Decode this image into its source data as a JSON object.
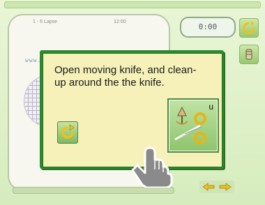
{
  "window": {
    "header_left_text": "1 - 6 Lapse",
    "header_right_text": "12:00"
  },
  "stitch_preview": "www.tajima.com",
  "status_segment": "0:00",
  "dialog": {
    "message": "Open moving knife, and clean-up around the the knife.",
    "button_badge": "u"
  },
  "icons": {
    "refresh": "refresh-icon",
    "bobbin": "bobbin-icon",
    "knife": "knife-clean-icon",
    "undo": "undo-icon",
    "hand": "pointer-hand-icon",
    "arrows": "arrows-icon"
  },
  "colors": {
    "background": "#dff0c7",
    "dialog_border": "#2b8a2e",
    "dialog_fill": "#f5f1b8",
    "button_fill": "#8fc46d",
    "icon_yellow": "#f1c216"
  }
}
